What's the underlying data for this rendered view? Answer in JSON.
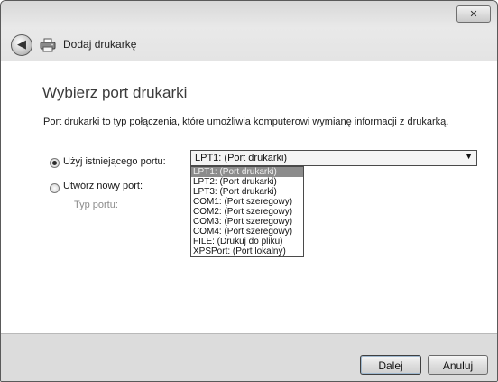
{
  "window": {
    "title": "Dodaj drukarkę",
    "close_glyph": "✕",
    "back_glyph": "◀",
    "icons": {
      "back": "back-arrow-icon",
      "printer": "printer-icon",
      "close": "close-icon"
    }
  },
  "main": {
    "heading": "Wybierz port drukarki",
    "intro": "Port drukarki to typ połączenia, które umożliwia komputerowi wymianę informacji z drukarką.",
    "existing_port_label": "Użyj istniejącego portu:",
    "existing_port_checked": true,
    "new_port_label": "Utwórz nowy port:",
    "new_port_checked": false,
    "port_type_label": "Typ portu:"
  },
  "port_select": {
    "selected": "LPT1: (Port drukarki)",
    "arrow_glyph": "▼",
    "options": [
      "LPT1: (Port drukarki)",
      "LPT2: (Port drukarki)",
      "LPT3: (Port drukarki)",
      "COM1: (Port szeregowy)",
      "COM2: (Port szeregowy)",
      "COM3: (Port szeregowy)",
      "COM4: (Port szeregowy)",
      "FILE: (Drukuj do pliku)",
      "XPSPort: (Port lokalny)"
    ],
    "highlighted_index": 0
  },
  "footer": {
    "next_label": "Dalej",
    "cancel_label": "Anuluj"
  }
}
